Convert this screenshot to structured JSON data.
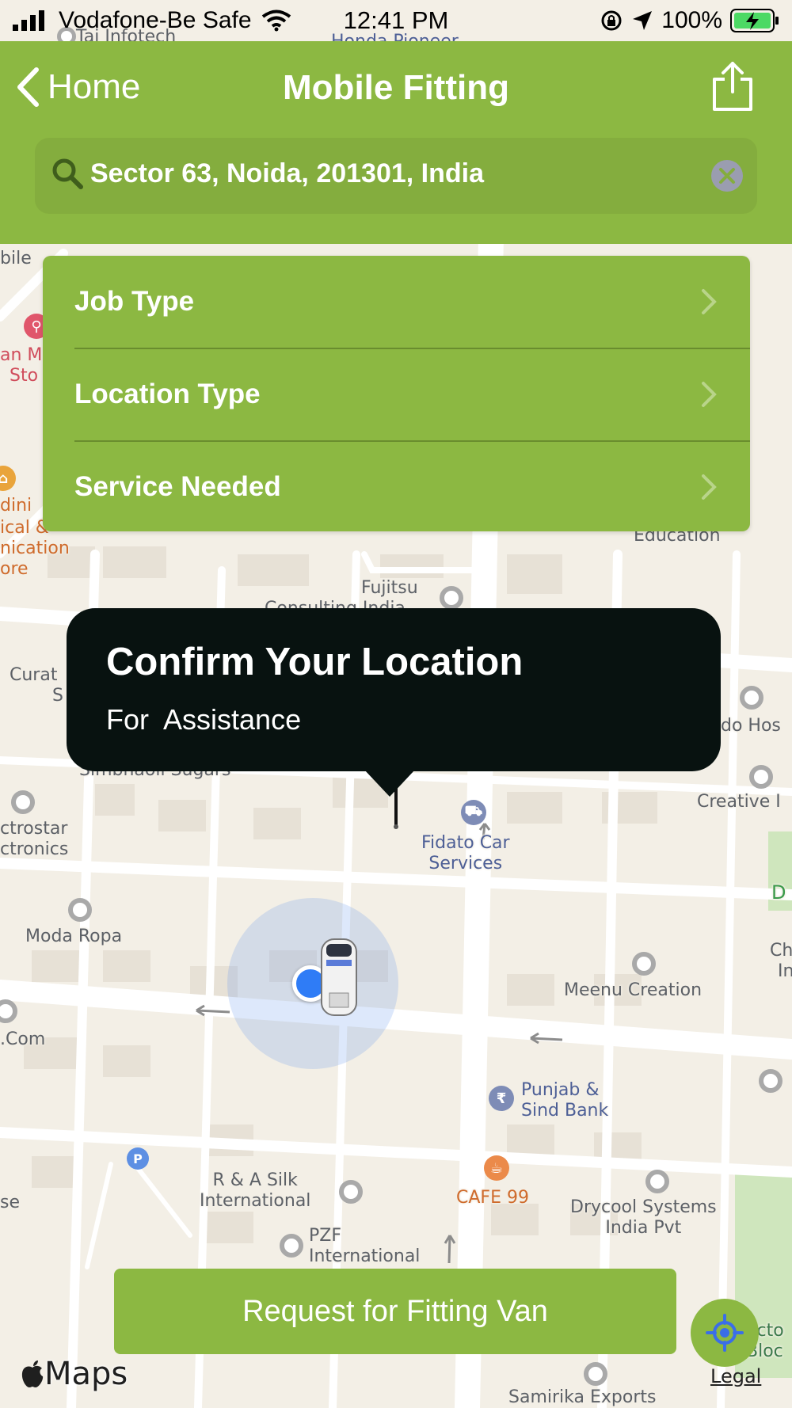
{
  "status_bar": {
    "carrier": "Vodafone-Be Safe",
    "time": "12:41 PM",
    "battery": "100%",
    "signal_icon": "signal-bars-icon",
    "wifi_icon": "wifi-icon",
    "lock_icon": "orientation-lock-icon",
    "location_icon": "location-arrow-icon",
    "battery_icon": "battery-charging-icon"
  },
  "header": {
    "back_label": "Home",
    "title": "Mobile Fitting",
    "share_icon": "share-icon"
  },
  "search": {
    "value": "Sector 63, Noida, 201301, India",
    "search_icon": "search-icon",
    "clear_icon": "clear-icon"
  },
  "options": [
    {
      "label": "Job Type"
    },
    {
      "label": "Location Type"
    },
    {
      "label": "Service Needed"
    }
  ],
  "callout": {
    "title": "Confirm Your Location",
    "subtitle": "For  Assistance"
  },
  "map_labels": {
    "tai_infotech": "Tai Infotech",
    "honda_pioneer": "Honda Pioneer",
    "bile": "bile",
    "an_m": "an M",
    "sto": "Sto",
    "dini": "dini",
    "ical": "ical &",
    "nication": "nication",
    "ore": "ore",
    "education": "Education",
    "fujitsu": "Fujitsu",
    "consulting": "Consulting India",
    "curat": "Curat",
    "s": "S",
    "simbhaoli": "Simbhaoli Sugars",
    "do_hos": "do Hos",
    "creative": "Creative I",
    "ctrostar": "ctrostar",
    "ctronics": "ctronics",
    "fidato": "Fidato Car\nServices",
    "d": "D",
    "moda_ropa": "Moda Ropa",
    "ch": "Ch",
    "in": "In",
    "meenu": "Meenu Creation",
    "com": ".Com",
    "punjab": "Punjab &\nSind Bank",
    "se": "se",
    "r_a_silk": "R & A Silk\nInternational",
    "cafe99": "CAFE 99",
    "drycool": "Drycool Systems\nIndia Pvt",
    "pzf": "PZF\nInternational",
    "ecto": "ecto",
    "bloc": "Bloc",
    "samirika": "Samirika Exports"
  },
  "request_button": {
    "label": "Request for Fitting Van"
  },
  "locate_button": {
    "icon": "crosshair-locate-icon"
  },
  "maps_logo": {
    "label": "Maps",
    "icon": "apple-logo-icon"
  },
  "legal": {
    "label": "Legal"
  },
  "colors": {
    "brand_green": "#8cb842",
    "callout_bg": "#081210",
    "user_dot": "#2f7cf6",
    "map_bg": "#f3efe6"
  }
}
